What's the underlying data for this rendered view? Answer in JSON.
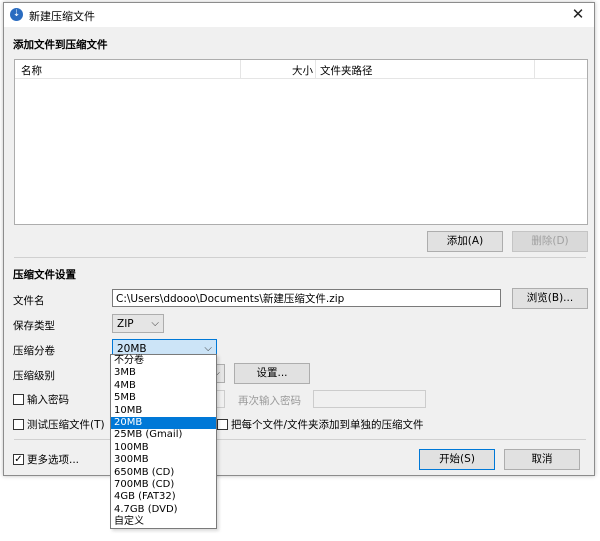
{
  "window": {
    "title": "新建压缩文件",
    "close_glyph": "✕"
  },
  "files_section": {
    "title": "添加文件到压缩文件",
    "columns": [
      "名称",
      "大小",
      "文件夹路径"
    ],
    "add_button": "添加(A)",
    "delete_button": "删除(D)"
  },
  "settings_section": {
    "title": "压缩文件设置",
    "filename_label": "文件名",
    "filename_value": "C:\\Users\\ddooo\\Documents\\新建压缩文件.zip",
    "browse_button": "浏览(B)...",
    "save_type_label": "保存类型",
    "save_type_value": "ZIP",
    "split_label": "压缩分卷",
    "split_value": "20MB",
    "level_label": "压缩级别",
    "settings_button": "设置...",
    "password_label": "输入密码",
    "reenter_password_label": "再次输入密码",
    "test_label": "测试压缩文件(T)",
    "separate_label": "把每个文件/文件夹添加到单独的压缩文件",
    "more_options_label": "更多选项...",
    "start_button": "开始(S)",
    "cancel_button": "取消"
  },
  "split_options": [
    "不分卷",
    "3MB",
    "4MB",
    "5MB",
    "10MB",
    "20MB",
    "25MB (Gmail)",
    "100MB",
    "300MB",
    "650MB (CD)",
    "700MB (CD)",
    "4GB (FAT32)",
    "4.7GB (DVD)",
    "自定义"
  ],
  "split_selected_index": 5,
  "checkbox_states": {
    "password": false,
    "test": false,
    "separate": false,
    "more_options": true
  },
  "colors": {
    "accent": "#0078d7",
    "window_bg": "#f0f0f0"
  }
}
